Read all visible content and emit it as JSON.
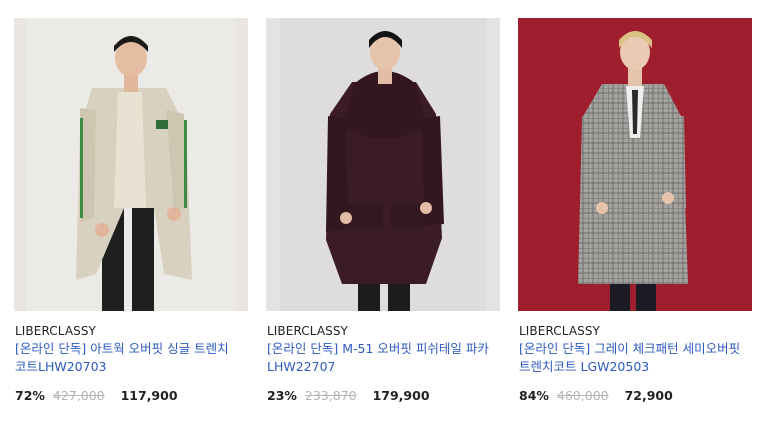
{
  "products": [
    {
      "brand": "LIBERCLASSY",
      "name": "[온라인 단독] 아트웍 오버핏 싱글 트렌치코트LHW20703",
      "discount": "72%",
      "original_price": "427,000",
      "final_price": "117,900",
      "image_icon": "model-beige-trench-coat",
      "background_color": "#e9e6e2",
      "coat_color": "#d9d1bf"
    },
    {
      "brand": "LIBERCLASSY",
      "name": "[온라인 단독] M-51 오버핏 피쉬테일 파카LHW22707",
      "discount": "23%",
      "original_price": "233,870",
      "final_price": "179,900",
      "image_icon": "model-burgundy-fishtail-parka",
      "background_color": "#e4e2e3",
      "coat_color": "#3b1c26"
    },
    {
      "brand": "LIBERCLASSY",
      "name": "[온라인 단독] 그레이 체크패턴 세미오버핏 트렌치코트 LGW20503",
      "discount": "84%",
      "original_price": "460,000",
      "final_price": "72,900",
      "image_icon": "model-gray-check-trench-coat",
      "background_color": "#9e1e2e",
      "coat_color": "#9a9a98"
    }
  ]
}
